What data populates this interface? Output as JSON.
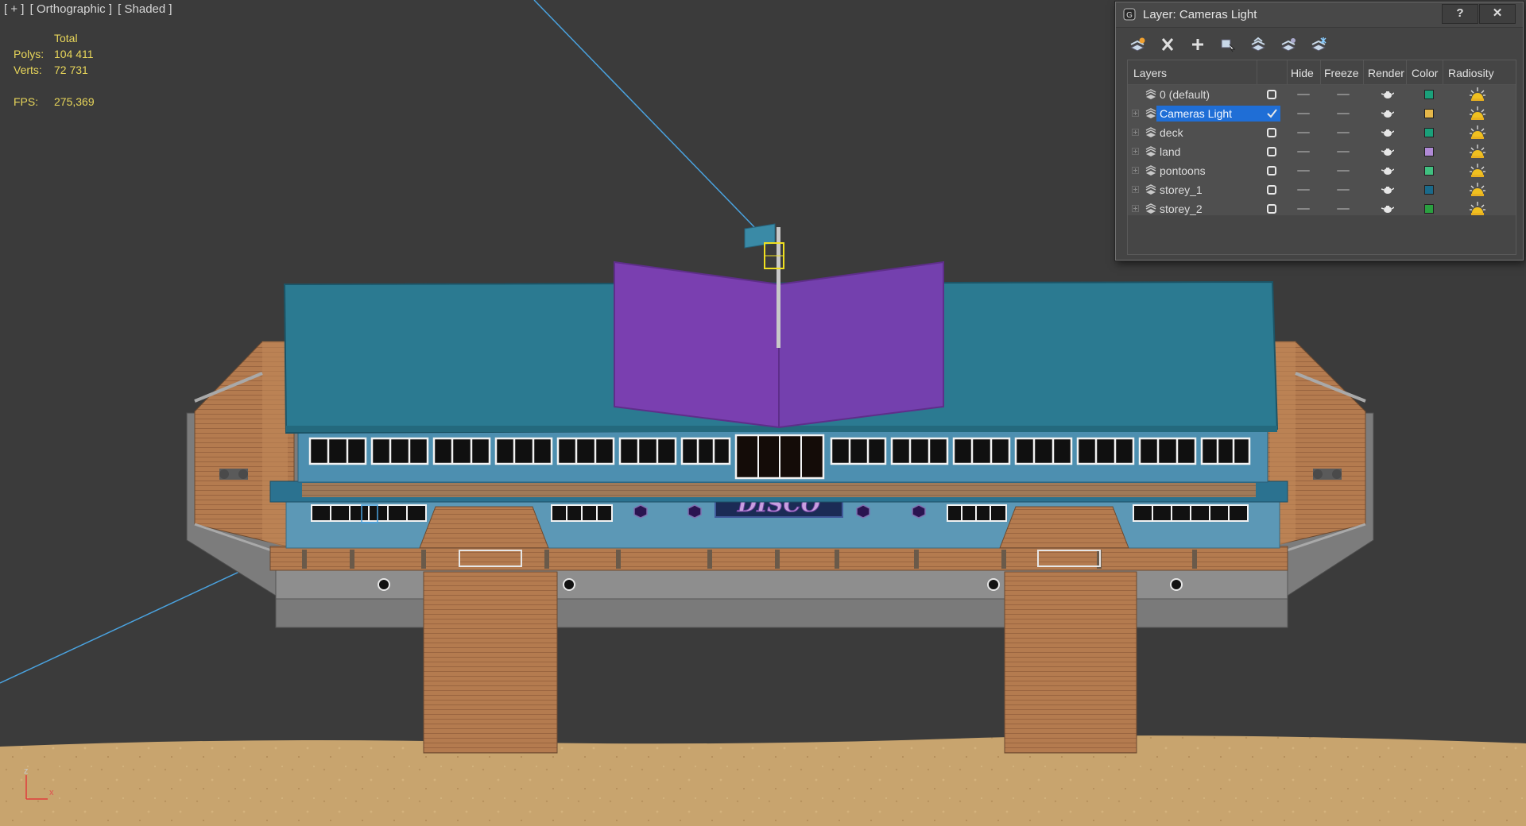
{
  "viewport": {
    "label_parts": [
      "[ + ]",
      "[ Orthographic ]",
      "[ Shaded ]"
    ],
    "stats": {
      "header": "Total",
      "polys_label": "Polys:",
      "polys_value": "104 411",
      "verts_label": "Verts:",
      "verts_value": "72 731",
      "fps_label": "FPS:",
      "fps_value": "275,369"
    },
    "sign_text": "DISCO",
    "axis": {
      "z": "z",
      "x": "x"
    },
    "colors": {
      "background": "#3b3b3b",
      "roof": "#2b7a91",
      "purple_panels": "#7a3fb0",
      "wood": "#b57a4e",
      "sand": "#c9a66f",
      "camera_line": "#4aa3e0",
      "selection_box": "#f0e020"
    }
  },
  "dialog": {
    "title": "Layer: Cameras Light",
    "help_label": "?",
    "close_label": "✕",
    "toolbar": [
      {
        "icon": "create-layer-icon"
      },
      {
        "icon": "delete-layer-icon"
      },
      {
        "icon": "add-to-layer-icon"
      },
      {
        "icon": "select-objects-icon"
      },
      {
        "icon": "highlight-layer-icon"
      },
      {
        "icon": "hide-all-layers-icon"
      },
      {
        "icon": "freeze-all-layers-icon"
      }
    ],
    "columns": {
      "layers": "Layers",
      "hide": "Hide",
      "freeze": "Freeze",
      "render": "Render",
      "color": "Color",
      "radiosity": "Radiosity"
    },
    "layers": [
      {
        "name": "0 (default)",
        "current": false,
        "color": "#1aa07a",
        "expandable": false,
        "active": false
      },
      {
        "name": "Cameras Light",
        "current": true,
        "color": "#e6b84a",
        "expandable": true,
        "active": true
      },
      {
        "name": "deck",
        "current": false,
        "color": "#1aa07a",
        "expandable": true,
        "active": false
      },
      {
        "name": "land",
        "current": false,
        "color": "#b08ad6",
        "expandable": true,
        "active": false
      },
      {
        "name": "pontoons",
        "current": false,
        "color": "#40c080",
        "expandable": true,
        "active": false
      },
      {
        "name": "storey_1",
        "current": false,
        "color": "#1a6a8a",
        "expandable": true,
        "active": false
      },
      {
        "name": "storey_2",
        "current": false,
        "color": "#2aa040",
        "expandable": true,
        "active": false
      }
    ]
  }
}
